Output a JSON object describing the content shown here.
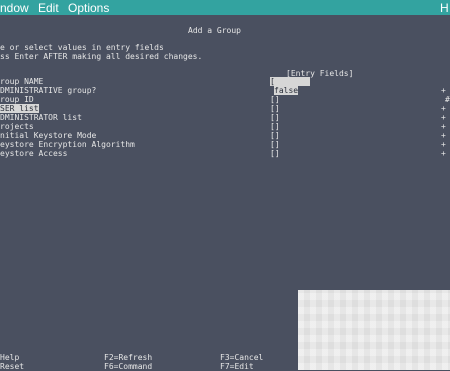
{
  "menu": {
    "window": "ndow",
    "edit": "Edit",
    "options": "Options",
    "help": "H"
  },
  "screen": {
    "title": "Add a Group",
    "instruction1": "e or select values in entry fields",
    "instruction2": "ss Enter AFTER making all desired changes.",
    "entry_fields_header": "[Entry Fields]"
  },
  "fields": [
    {
      "label": "roup NAME",
      "value": "[",
      "marker": ""
    },
    {
      "label": "DMINISTRATIVE group?",
      "value": "false",
      "marker": "+"
    },
    {
      "label": "roup ID",
      "value": "[]",
      "marker": "#"
    },
    {
      "label": "SER list",
      "value": "[]",
      "marker": "+"
    },
    {
      "label": "DMINISTRATOR list",
      "value": "[]",
      "marker": "+"
    },
    {
      "label": "rojects",
      "value": "[]",
      "marker": "+"
    },
    {
      "label": "nitial Keystore Mode",
      "value": "[]",
      "marker": "+"
    },
    {
      "label": "eystore Encryption Algorithm",
      "value": "[]",
      "marker": "+"
    },
    {
      "label": "eystore Access",
      "value": "[]",
      "marker": "+"
    }
  ],
  "fkeys": {
    "f1": "Help",
    "f2": "F2=Refresh",
    "f3": "F3=Cancel",
    "f5": "Reset",
    "f6": "F6=Command",
    "f7": "F7=Edit"
  }
}
